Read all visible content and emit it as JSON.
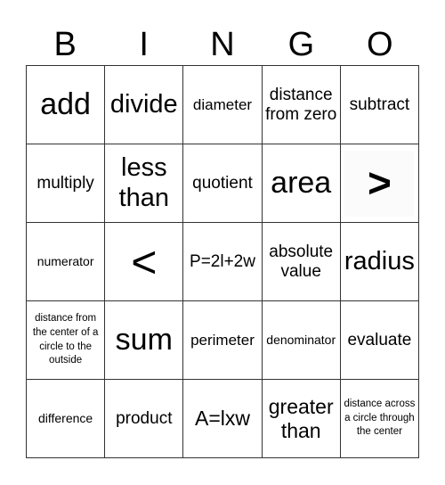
{
  "header": {
    "letters": [
      "B",
      "I",
      "N",
      "G",
      "O"
    ]
  },
  "board": {
    "rows": [
      [
        "add",
        "divide",
        "diameter",
        "distance from zero",
        "subtract"
      ],
      [
        "multiply",
        "less than",
        "quotient",
        "area",
        ">"
      ],
      [
        "numerator",
        "<",
        "P=2l+2w",
        "absolute value",
        "radius"
      ],
      [
        "distance from the center of a circle to the outside",
        "sum",
        "perimeter",
        "denominator",
        "evaluate"
      ],
      [
        "difference",
        "product",
        "A=lxw",
        "greater than",
        "distance across a circle through the center"
      ]
    ]
  }
}
